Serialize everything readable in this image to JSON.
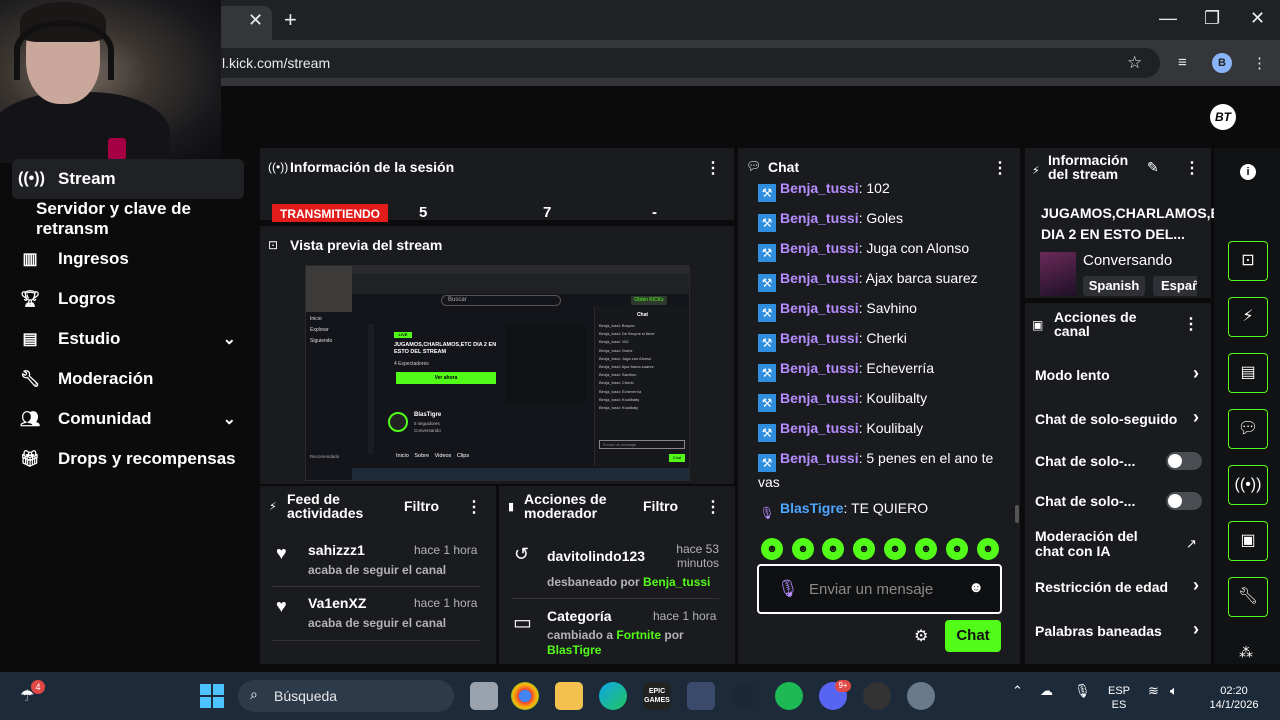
{
  "browser": {
    "url": "l.kick.com/stream",
    "profile_initial": "B",
    "new_tab_symbol": "+",
    "close_symbol": "✕"
  },
  "sidebar": {
    "items": [
      {
        "label": "Stream",
        "icon": "broadcast-icon"
      },
      {
        "label": "Servidor y clave de retransm"
      },
      {
        "label": "Ingresos",
        "icon": "chart-icon"
      },
      {
        "label": "Logros",
        "icon": "trophy-icon"
      },
      {
        "label": "Estudio",
        "icon": "studio-icon"
      },
      {
        "label": "Moderación",
        "icon": "wrench-icon"
      },
      {
        "label": "Comunidad",
        "icon": "community-icon"
      },
      {
        "label": "Drops y recompensas",
        "icon": "gift-icon"
      }
    ]
  },
  "session": {
    "title": "Información de la sesión",
    "live_label": "TRANSMITIENDO",
    "stat1": "5",
    "stat2": "7",
    "stat3": "-"
  },
  "preview": {
    "title": "Vista previa del stream",
    "thumb": {
      "search": "Buscar",
      "obtain": "Obtén KICKs",
      "chat": "Chat",
      "live": "LIVE",
      "stream_title": "JUGAMOS,CHARLAMOS,ETC DIA 2 EN ESTO DEL STREAM",
      "viewers": "4 Espectadores",
      "watch_now": "Ver ahora",
      "channel": "BlasTigre",
      "followers": "5 seguidores",
      "tags": [
        "Conversando",
        "Spanish",
        "Español",
        "LIVE"
      ],
      "nav": [
        "Inicio",
        "Explorar",
        "Siguiendo"
      ],
      "tabs": [
        "Inicio",
        "Sobre",
        "Videos",
        "Clips"
      ],
      "recomendado": "Recomendado",
      "input_ph": "Enviar un mensaje",
      "chat_btn": "Chat",
      "chat_lines": [
        "Benja_tussi: Bruyne",
        "Benja_tussi: De Bruyne si tiene",
        "Benja_tussi: 102",
        "Benja_tussi: Goles",
        "Benja_tussi: Juga con Alonso",
        "Benja_tussi: Ajax barca suarez",
        "Benja_tussi: Savhino",
        "Benja_tussi: Cherki",
        "Benja_tussi: Echeverría",
        "Benja_tussi: Koulibalty",
        "Benja_tussi: Koulibaly"
      ]
    }
  },
  "feed": {
    "title": "Feed de actividades",
    "filter": "Filtro",
    "items": [
      {
        "name": "sahizzz1",
        "time": "hace 1 hora",
        "action": "acaba de seguir el canal"
      },
      {
        "name": "Va1enXZ",
        "time": "hace 1 hora",
        "action": "acaba de seguir el canal"
      }
    ]
  },
  "mods": {
    "title": "Acciones de moderador",
    "filter": "Filtro",
    "item1": {
      "name": "davitolindo123",
      "time": "hace 53 minutos",
      "action": "desbaneado por",
      "by": "Benja_tussi"
    },
    "item2": {
      "name": "Categoría",
      "time": "hace 1 hora",
      "action": "cambiado a",
      "category": "Fortnite",
      "por": "por",
      "by": "BlasTigre"
    }
  },
  "chat": {
    "title": "Chat",
    "messages": [
      {
        "user": "Benja_tussi",
        "text": ": 102"
      },
      {
        "user": "Benja_tussi",
        "text": ": Goles"
      },
      {
        "user": "Benja_tussi",
        "text": ": Juga con Alonso"
      },
      {
        "user": "Benja_tussi",
        "text": ": Ajax barca suarez"
      },
      {
        "user": "Benja_tussi",
        "text": ": Savhino"
      },
      {
        "user": "Benja_tussi",
        "text": ": Cherki"
      },
      {
        "user": "Benja_tussi",
        "text": ": Echeverría"
      },
      {
        "user": "Benja_tussi",
        "text": ": Koulibalty"
      },
      {
        "user": "Benja_tussi",
        "text": ": Koulibaly"
      },
      {
        "user": "Benja_tussi",
        "text": ": 5 penes en el ano te vas"
      },
      {
        "user": "BlasTigre",
        "text": ": TE QUIERO"
      }
    ],
    "placeholder": "Enviar un mensaje",
    "send_label": "Chat"
  },
  "stream_info": {
    "title": "Información del stream",
    "stream_title": "JUGAMOS,CHARLAMOS,ETC DIA 2 EN ESTO DEL...",
    "category": "Conversando",
    "tags": [
      "Spanish",
      "Españ"
    ]
  },
  "channel_actions": {
    "title": "Acciones de canal",
    "rows": [
      "Modo lento",
      "Chat de solo-seguido",
      "Chat de solo-...",
      "Chat de solo-...",
      "Moderación del chat con IA",
      "Restricción de edad",
      "Palabras baneadas"
    ]
  },
  "taskbar": {
    "weather_badge": "4",
    "search_placeholder": "Búsqueda",
    "lang": "ESP",
    "lang2": "ES",
    "time": "02:20",
    "date": "14/1/2026",
    "discord_badge": "9+",
    "epic": "EPIC GAMES"
  },
  "colors": {
    "accent": "#53fc18",
    "live": "#e21b1b",
    "username": "#b78cff"
  }
}
